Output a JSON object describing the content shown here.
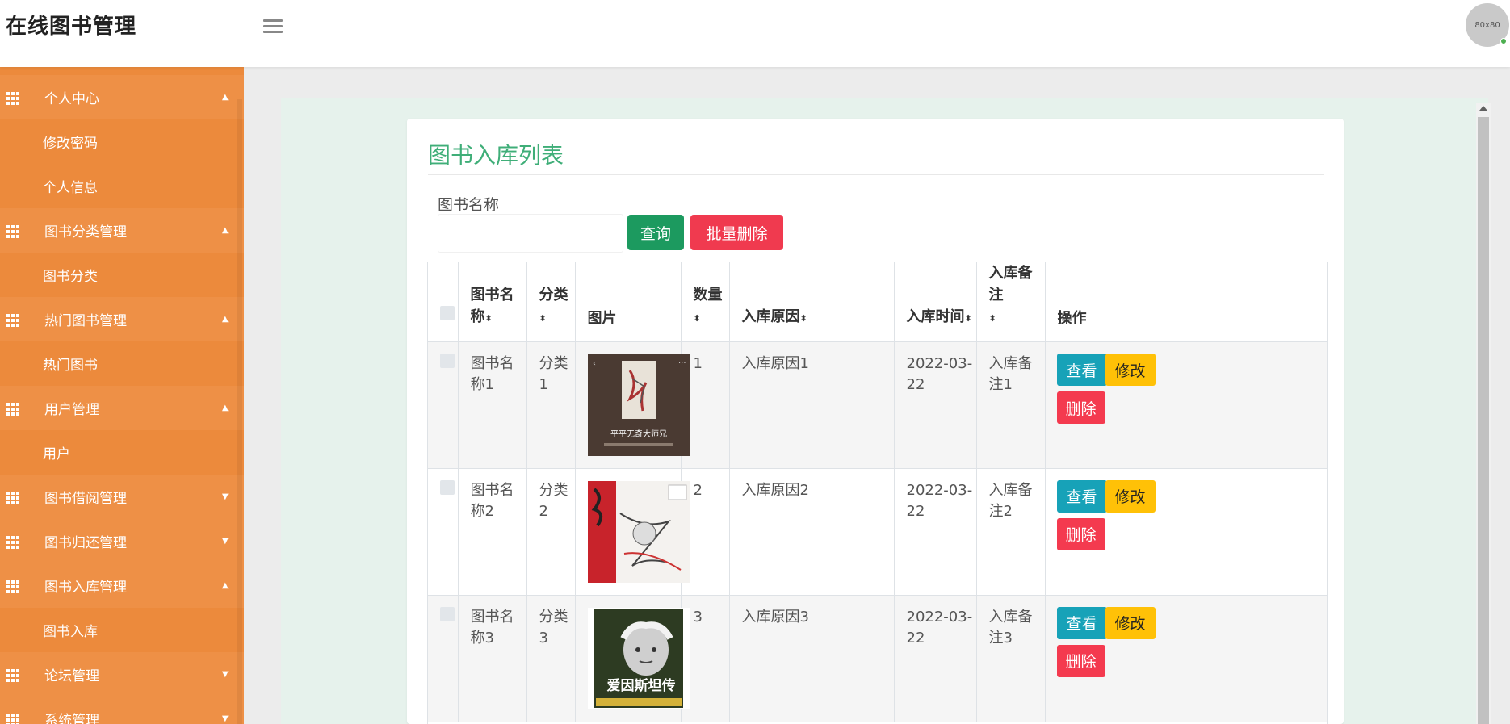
{
  "header": {
    "app_title": "在线图书管理",
    "avatar_text": "80x80"
  },
  "sidebar": {
    "items": [
      {
        "type": "group",
        "label": "个人中心",
        "caret": "▲"
      },
      {
        "type": "sub",
        "label": "修改密码"
      },
      {
        "type": "sub",
        "label": "个人信息"
      },
      {
        "type": "group",
        "label": "图书分类管理",
        "caret": "▲"
      },
      {
        "type": "sub",
        "label": "图书分类"
      },
      {
        "type": "group",
        "label": "热门图书管理",
        "caret": "▲"
      },
      {
        "type": "sub",
        "label": "热门图书"
      },
      {
        "type": "group",
        "label": "用户管理",
        "caret": "▲"
      },
      {
        "type": "sub",
        "label": "用户"
      },
      {
        "type": "group",
        "label": "图书借阅管理",
        "caret": "▼"
      },
      {
        "type": "group",
        "label": "图书归还管理",
        "caret": "▼"
      },
      {
        "type": "group",
        "label": "图书入库管理",
        "caret": "▲"
      },
      {
        "type": "sub",
        "label": "图书入库"
      },
      {
        "type": "group",
        "label": "论坛管理",
        "caret": "▼"
      },
      {
        "type": "group",
        "label": "系统管理",
        "caret": "▼"
      }
    ]
  },
  "page": {
    "title": "图书入库列表",
    "search_label": "图书名称",
    "search_value": "",
    "query_button": "查询",
    "batch_delete_button": "批量删除"
  },
  "table": {
    "columns": [
      "",
      "图书名称",
      "分类",
      "图片",
      "数量",
      "入库原因",
      "入库时间",
      "入库备注",
      "操作"
    ],
    "sort_icon": "⬍",
    "rows": [
      {
        "name": "图书名称1",
        "category": "分类1",
        "cover": "cover-1",
        "quantity": "1",
        "reason": "入库原因1",
        "time": "2022-03-22",
        "remark": "入库备注1"
      },
      {
        "name": "图书名称2",
        "category": "分类2",
        "cover": "cover-2",
        "quantity": "2",
        "reason": "入库原因2",
        "time": "2022-03-22",
        "remark": "入库备注2"
      },
      {
        "name": "图书名称3",
        "category": "分类3",
        "cover": "cover-3",
        "quantity": "3",
        "reason": "入库原因3",
        "time": "2022-03-22",
        "remark": "入库备注3"
      }
    ],
    "actions": {
      "view": "查看",
      "edit": "修改",
      "delete": "删除"
    }
  },
  "covers": {
    "cover1_text": "平平无奇大师兄",
    "cover3_text": "爱因斯坦传"
  },
  "colors": {
    "sidebar_bg": "#ec8a3c",
    "title_green": "#3fae78",
    "query_green": "#1c9a5f",
    "danger_red": "#f03a4f",
    "info_teal": "#17a2b8",
    "warning_yellow": "#ffc107"
  }
}
